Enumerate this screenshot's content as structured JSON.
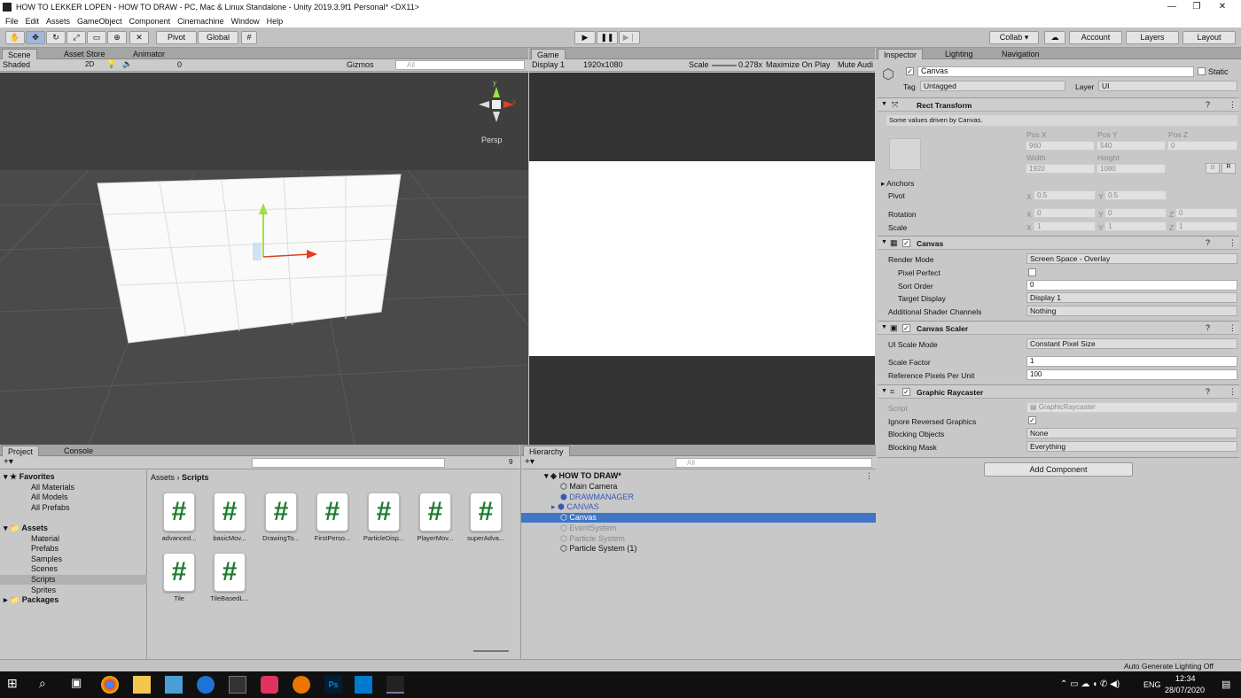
{
  "window": {
    "title": "HOW TO LEKKER LOPEN - HOW TO DRAW - PC, Mac & Linux Standalone - Unity 2019.3.9f1 Personal* <DX11>"
  },
  "menu": [
    "File",
    "Edit",
    "Assets",
    "GameObject",
    "Component",
    "Cinemachine",
    "Window",
    "Help"
  ],
  "toolbar": {
    "pivot": "Pivot",
    "global": "Global",
    "collab": "Collab ▾",
    "account": "Account",
    "layers": "Layers",
    "layout": "Layout"
  },
  "scene": {
    "tabs": [
      "Scene",
      "Asset Store",
      "Animator"
    ],
    "shading": "Shaded",
    "mode2d": "2D",
    "hidden_count": "0",
    "gizmos": "Gizmos",
    "search_placeholder": "All",
    "persp": "Persp",
    "axis_x": "x",
    "axis_y": "y"
  },
  "game": {
    "tab": "Game",
    "display": "Display 1",
    "resolution": "1920x1080",
    "scale_label": "Scale",
    "scale_value": "0.278x",
    "maximize": "Maximize On Play",
    "mute": "Mute Audi"
  },
  "inspector": {
    "tabs": [
      "Inspector",
      "Lighting",
      "Navigation"
    ],
    "object_name": "Canvas",
    "static": "Static",
    "tag_label": "Tag",
    "tag_value": "Untagged",
    "layer_label": "Layer",
    "layer_value": "UI",
    "rect": {
      "title": "Rect Transform",
      "note": "Some values driven by Canvas.",
      "pos_x_label": "Pos X",
      "pos_y_label": "Pos Y",
      "pos_z_label": "Pos Z",
      "pos_x": "960",
      "pos_y": "540",
      "pos_z": "0",
      "width_label": "Width",
      "height_label": "Height",
      "width": "1920",
      "height": "1080",
      "r_button": "R",
      "anchors": "Anchors",
      "pivot_label": "Pivot",
      "pivot_x": "0.5",
      "pivot_y": "0.5",
      "rotation_label": "Rotation",
      "rot_x": "0",
      "rot_y": "0",
      "rot_z": "0",
      "scale_label": "Scale",
      "scale_x": "1",
      "scale_y": "1",
      "scale_z": "1",
      "x": "X",
      "y": "Y",
      "z": "Z"
    },
    "canvas": {
      "title": "Canvas",
      "render_mode_label": "Render Mode",
      "render_mode": "Screen Space - Overlay",
      "pixel_perfect": "Pixel Perfect",
      "sort_order_label": "Sort Order",
      "sort_order": "0",
      "target_display_label": "Target Display",
      "target_display": "Display 1",
      "shader_channels_label": "Additional Shader Channels",
      "shader_channels": "Nothing"
    },
    "scaler": {
      "title": "Canvas Scaler",
      "ui_scale_label": "UI Scale Mode",
      "ui_scale": "Constant Pixel Size",
      "scale_factor_label": "Scale Factor",
      "scale_factor": "1",
      "ref_ppu_label": "Reference Pixels Per Unit",
      "ref_ppu": "100"
    },
    "raycaster": {
      "title": "Graphic Raycaster",
      "script_label": "Script",
      "script": "GraphicRaycaster",
      "ignore_label": "Ignore Reversed Graphics",
      "blocking_objects_label": "Blocking Objects",
      "blocking_objects": "None",
      "blocking_mask_label": "Blocking Mask",
      "blocking_mask": "Everything"
    },
    "add_component": "Add Component"
  },
  "project": {
    "tabs": [
      "Project",
      "Console"
    ],
    "hidden_count": "9",
    "breadcrumb_root": "Assets",
    "breadcrumb_current": "Scripts",
    "favorites": "Favorites",
    "favorite_items": [
      "All Materials",
      "All Models",
      "All Prefabs"
    ],
    "assets": "Assets",
    "asset_folders": [
      "Material",
      "Prefabs",
      "Samples",
      "Scenes",
      "Scripts",
      "Sprites"
    ],
    "packages": "Packages",
    "scripts": [
      "advanced...",
      "basicMov...",
      "DrawingTo...",
      "FirstPerso...",
      "ParticleDisp...",
      "PlayerMov...",
      "superAdva...",
      "Tile",
      "TileBasedL..."
    ]
  },
  "hierarchy": {
    "tab": "Hierarchy",
    "search_placeholder": "All",
    "scene_name": "HOW TO DRAW*",
    "items": [
      "Main Camera",
      "DRAWMANAGER",
      "CANVAS",
      "Canvas",
      "EventSystem",
      "Particle System",
      "Particle System (1)"
    ]
  },
  "statusbar": {
    "right": "Auto Generate Lighting Off"
  },
  "taskbar": {
    "lang": "ENG",
    "time": "12:34",
    "date": "28/07/2020"
  }
}
